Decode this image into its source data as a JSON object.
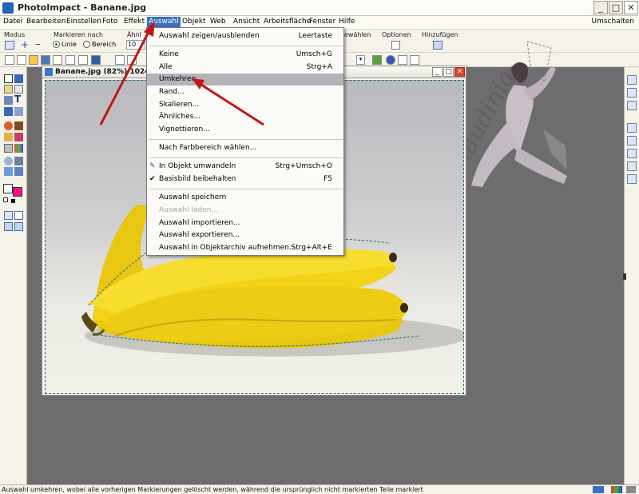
{
  "window": {
    "title": "PhotoImpact - Banane.jpg",
    "min": "_",
    "max": "□",
    "close": "✕"
  },
  "menubar": {
    "items": [
      "Datei",
      "Bearbeiten",
      "Einstellen",
      "Foto",
      "Effekt",
      "Auswahl",
      "Objekt",
      "Web",
      "Ansicht",
      "Arbeitsfläche",
      "Fenster",
      "Hilfe"
    ],
    "right": "Umschalten"
  },
  "attrbar": {
    "modus": "Modus",
    "markieren_nach": "Markieren nach",
    "linie": "Linie",
    "bereich": "Bereich",
    "ahnl": "Ähnl",
    "ahnl_value": "10",
    "waehlen": "ewählen",
    "optionen": "Optionen",
    "hinzufuegen": "Hinzufügen"
  },
  "document": {
    "title": "Banane.jpg (82%) 1024x"
  },
  "dropdown": {
    "items": [
      {
        "label": "Auswahl zeigen/ausblenden",
        "shortcut": "Leertaste"
      },
      {
        "label": "Keine",
        "shortcut": "Umsch+G"
      },
      {
        "label": "Alle",
        "shortcut": "Strg+A"
      },
      {
        "label": "Umkehren",
        "shortcut": ""
      },
      {
        "label": "Rand...",
        "shortcut": ""
      },
      {
        "label": "Skalieren...",
        "shortcut": ""
      },
      {
        "label": "Ähnliches...",
        "shortcut": ""
      },
      {
        "label": "Vignettieren...",
        "shortcut": ""
      },
      {
        "label": "Nach Farbbereich wählen...",
        "shortcut": ""
      },
      {
        "label": "In Objekt umwandeln",
        "shortcut": "Strg+Umsch+O"
      },
      {
        "label": "Basisbild beibehalten",
        "shortcut": "F5"
      },
      {
        "label": "Auswahl speichern",
        "shortcut": ""
      },
      {
        "label": "Auswahl laden...",
        "shortcut": ""
      },
      {
        "label": "Auswahl importieren...",
        "shortcut": ""
      },
      {
        "label": "Auswahl exportieren...",
        "shortcut": ""
      },
      {
        "label": "Auswahl in Objektarchiv aufnehmen...",
        "shortcut": "Strg+Alt+E"
      }
    ]
  },
  "watermark": {
    "text": "©Claudinia"
  },
  "statusbar": {
    "text": "Auswahl umkehren, wobei alle vorherigen Markierungen gelöscht werden, während die ursprünglich nicht markierten Teile markiert"
  },
  "colors": {
    "menu_highlight": "#b3b3b8",
    "active_menu": "#3b6fbf",
    "arrow": "#c01818",
    "foreground_swatch": "#ffffff",
    "background_swatch": "#ff0f86",
    "banana": "#f2d317"
  }
}
